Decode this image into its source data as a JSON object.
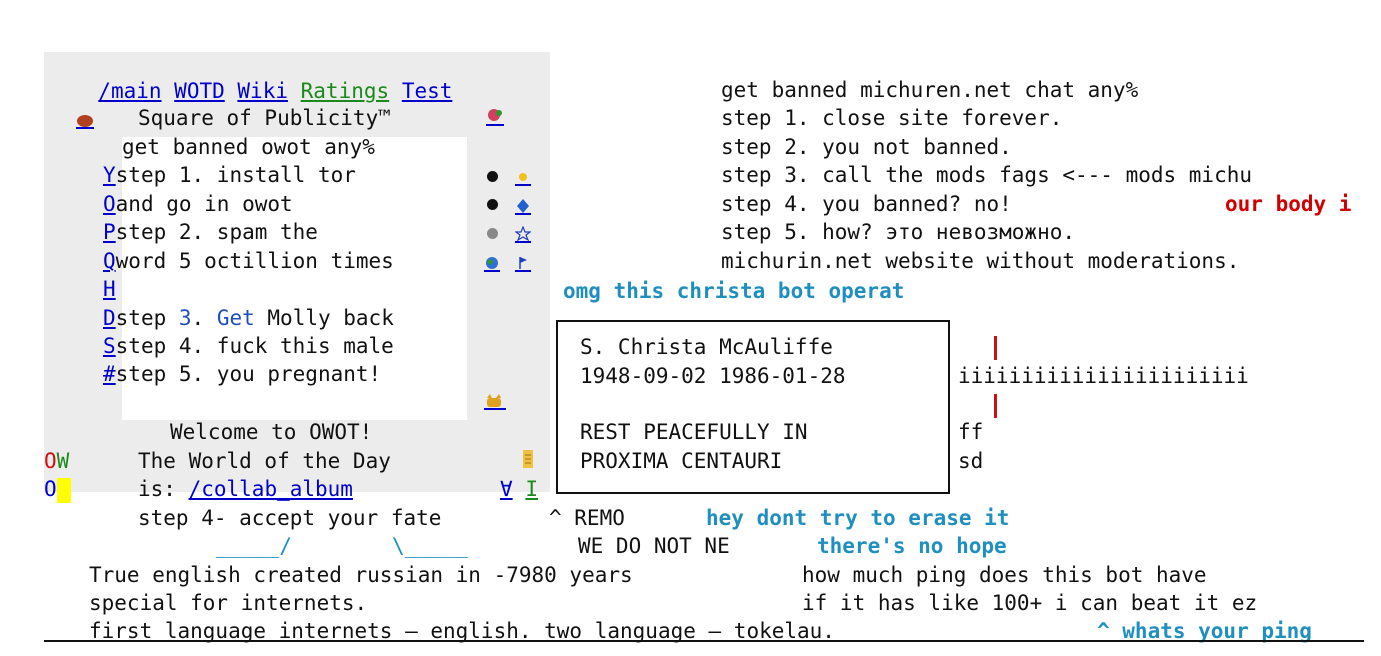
{
  "nav": {
    "main": "/main",
    "wotd": "WOTD",
    "wiki": "Wiki",
    "ratings": "Ratings",
    "test": "Test"
  },
  "panel": {
    "title": "Square of Publicity™",
    "header_line": "get banned owot any%",
    "rows": [
      {
        "link": "Y",
        "text": "step 1. install tor"
      },
      {
        "link": "O",
        "text": "and go in owot"
      },
      {
        "link": "P",
        "text": "step 2. spam the"
      },
      {
        "link": "Q",
        "text": "word 5 octillion times"
      },
      {
        "link": "H",
        "text": ""
      },
      {
        "link": "D",
        "text": "step 3. Get Molly back"
      },
      {
        "link": "S",
        "text": "step 4. fuck this male"
      },
      {
        "link": "#",
        "text": "step 5. you pregnant!"
      }
    ],
    "welcome": "Welcome to OWOT!",
    "wotd_line": "The World of the Day",
    "wotd_is": "is:",
    "wotd_link": "/collab_album",
    "step4": "step 4- accept your fate",
    "arrow_left": "_____/",
    "arrow_right": "\\_____",
    "side_ow": "OW",
    "side_o": "O",
    "caret_remo": "^ REMO",
    "we_do_not": "WE DO NOT NE",
    "bottom_links": [
      "∀",
      "I"
    ]
  },
  "right_text": {
    "lines": [
      "get banned michuren.net chat any%",
      "step 1. close site forever.",
      "step 2. you not banned.",
      "step 3. call the mods fags <--- mods michu",
      "step 4. you banned? no!",
      "step 5. how? это невозможно.",
      "michurin.net website without moderations."
    ],
    "red_fragment": "our body i"
  },
  "omg_line": "omg this christa bot operat",
  "grave": {
    "name": "S. Christa McAuliffe",
    "dates": "1948-09-02 1986-01-28",
    "rest1": "REST PEACEFULLY IN",
    "rest2": "PROXIMA CENTAURI"
  },
  "side_of_grave": {
    "i_line": "iiiiiiiiiiiiiiiiiiiiiii",
    "ff": "ff",
    "sd": "sd"
  },
  "cyan_lines": {
    "erase": "hey dont try to erase it",
    "hope": "there's no hope"
  },
  "bottom": {
    "left1": "True english created russian in -7980 years",
    "left2": "special for internets.",
    "left3": "first language internets — english. two language — tokelau.",
    "right1": "how much ping does this bot have",
    "right2": "if it has like 100+ i can beat it ez",
    "right3": "^ whats your ping"
  },
  "icons": [
    "meat-icon",
    "flower-icon",
    "dot-icon",
    "sun-icon",
    "diamond-icon",
    "star-icon",
    "earth-icon",
    "flag-icon",
    "cat-icon",
    "scroll-icon"
  ]
}
